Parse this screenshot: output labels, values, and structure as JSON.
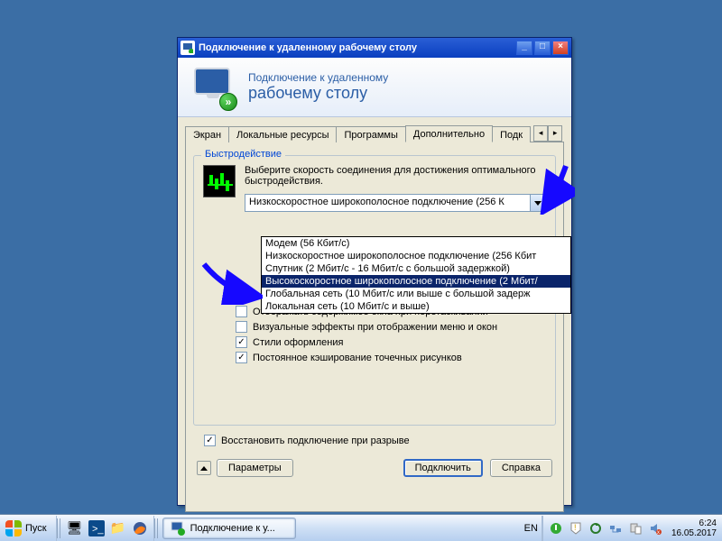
{
  "window": {
    "title": "Подключение к удаленному рабочему столу",
    "banner_line1": "Подключение к удаленному",
    "banner_line2": "рабочему столу"
  },
  "tabs": {
    "items": [
      "Экран",
      "Локальные ресурсы",
      "Программы",
      "Дополнительно",
      "Подк"
    ],
    "active_index": 3
  },
  "perf": {
    "group_label": "Быстродействие",
    "hint": "Выберите скорость соединения для достижения оптимального быстродействия.",
    "combo_selected": "Низкоскоростное широкополосное подключение (256 К",
    "dropdown": {
      "items": [
        "Модем (56 Кбит/с)",
        "Низкоскоростное широкополосное подключение (256 Кбит",
        "Спутник (2 Мбит/с - 16 Мбит/с с большой задержкой)",
        "Высокоскоростное широкополосное подключение (2 Мбит/",
        "Глобальная сеть (10 Мбит/с или выше с большой задерж",
        "Локальная сеть (10 Мбит/с и выше)"
      ],
      "highlighted_index": 3
    },
    "checks": [
      {
        "label": "Отображать содержимое окна при перетаскивании",
        "checked": false,
        "enabled": true
      },
      {
        "label": "Визуальные эффекты при отображении меню и окон",
        "checked": false,
        "enabled": true
      },
      {
        "label": "Стили оформления",
        "checked": true,
        "enabled": true
      },
      {
        "label": "Постоянное кэширование точечных рисунков",
        "checked": true,
        "enabled": true
      }
    ]
  },
  "reconnect": {
    "label": "Восстановить подключение при разрыве",
    "checked": true
  },
  "buttons": {
    "params": "Параметры",
    "connect": "Подключить",
    "help": "Справка"
  },
  "taskbar": {
    "start": "Пуск",
    "active_task": "Подключение к у...",
    "lang": "EN",
    "time": "6:24",
    "date": "16.05.2017"
  }
}
